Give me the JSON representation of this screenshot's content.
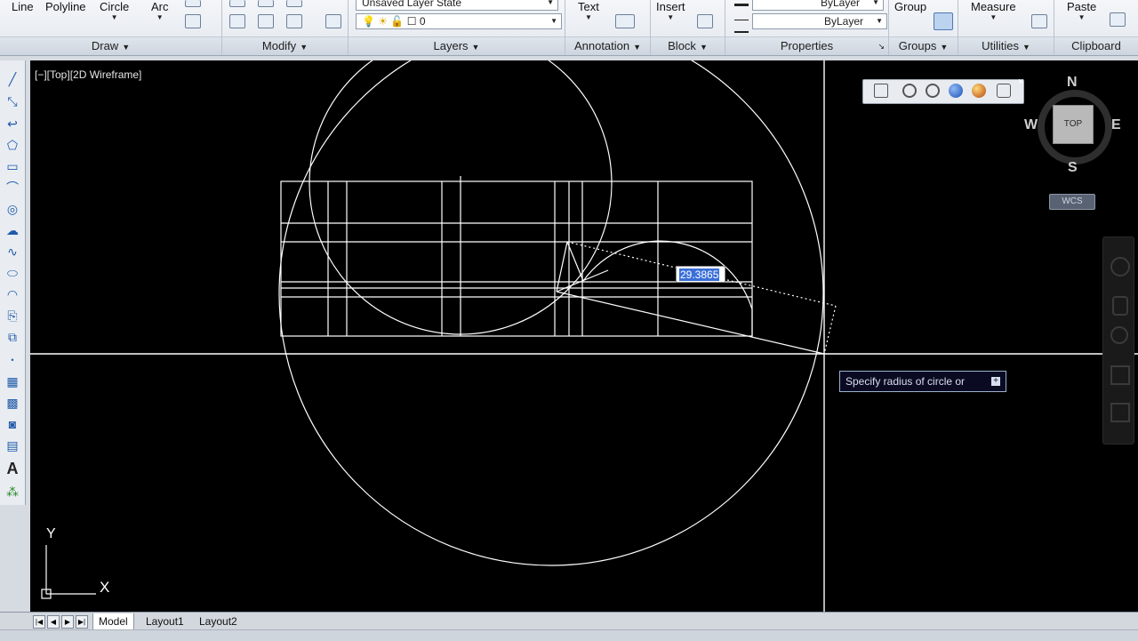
{
  "ribbon": {
    "draw": {
      "title": "Draw",
      "line": "Line",
      "polyline": "Polyline",
      "circle": "Circle",
      "arc": "Arc"
    },
    "modify": {
      "title": "Modify"
    },
    "layers": {
      "title": "Layers",
      "layer_state": "Unsaved Layer State",
      "current_layer": "0"
    },
    "annotation": {
      "title": "Annotation",
      "text": "Text"
    },
    "block": {
      "title": "Block",
      "insert": "Insert"
    },
    "properties": {
      "title": "Properties",
      "color": "ByLayer",
      "linetype": "ByLayer"
    },
    "groups": {
      "title": "Groups",
      "group": "Group"
    },
    "utilities": {
      "title": "Utilities",
      "measure": "Measure"
    },
    "clipboard": {
      "title": "Clipboard",
      "paste": "Paste"
    }
  },
  "viewport": {
    "label": "[−][Top][2D Wireframe]",
    "dynamic_input_value": "29.3865",
    "command_tooltip": "Specify radius of circle or",
    "ucs_x_label": "X",
    "ucs_y_label": "Y"
  },
  "viewcube": {
    "face": "TOP",
    "north": "N",
    "south": "S",
    "east": "E",
    "west": "W",
    "wcs": "WCS"
  },
  "layout_tabs": [
    {
      "label": "Model",
      "active": true
    },
    {
      "label": "Layout1",
      "active": false
    },
    {
      "label": "Layout2",
      "active": false
    }
  ],
  "colors": {
    "canvas": "#000000",
    "geometry": "#ffffff",
    "selection": "#3a6fd8",
    "tooltip_bg": "#0a0a22"
  }
}
